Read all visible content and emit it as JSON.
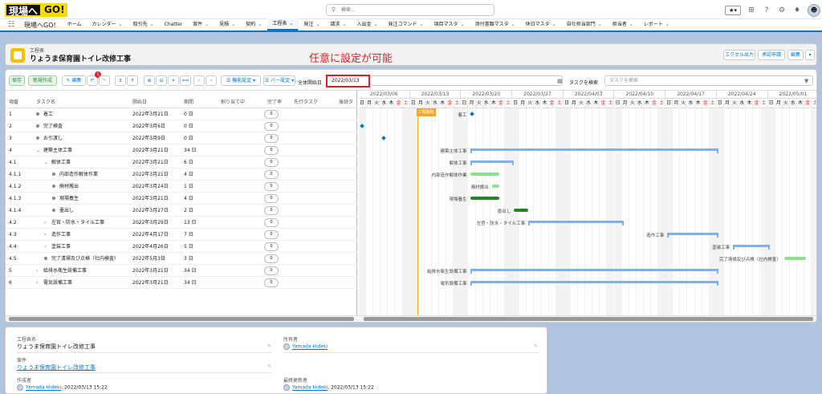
{
  "topbar": {
    "logo_text": "現場へ",
    "logo_text2": "GO!",
    "search_placeholder": "検索...",
    "fav_label": "★▾"
  },
  "nav": {
    "app_name": "現場へGO!",
    "tabs": [
      {
        "label": "ホーム",
        "dropdown": false
      },
      {
        "label": "カレンダー",
        "dropdown": true
      },
      {
        "label": "取引先",
        "dropdown": true
      },
      {
        "label": "Chatter",
        "dropdown": false
      },
      {
        "label": "案件",
        "dropdown": true
      },
      {
        "label": "見積",
        "dropdown": true
      },
      {
        "label": "契約",
        "dropdown": true
      },
      {
        "label": "工程表",
        "dropdown": true,
        "active": true
      },
      {
        "label": "発注",
        "dropdown": true
      },
      {
        "label": "請求",
        "dropdown": true
      },
      {
        "label": "入出金",
        "dropdown": true
      },
      {
        "label": "発注コマンド",
        "dropdown": true
      },
      {
        "label": "項目マスタ",
        "dropdown": true
      },
      {
        "label": "添付書類マスタ",
        "dropdown": true
      },
      {
        "label": "休日マスタ",
        "dropdown": true
      },
      {
        "label": "自社担当部門",
        "dropdown": true
      },
      {
        "label": "担当者",
        "dropdown": true
      },
      {
        "label": "レポート",
        "dropdown": true
      }
    ]
  },
  "header": {
    "object_type": "工程表",
    "record_name": "りょうま保育園トイレ改修工事",
    "buttons": [
      "エクセル出力",
      "承認申請",
      "編集"
    ],
    "more": "▾"
  },
  "annotation": "任意に設定が可能",
  "toolbar": {
    "save": "保存",
    "new": "新規作成",
    "edit": "編集",
    "undo_badge": "1",
    "function_settings": "機能設定",
    "bar_settings": "バー設定",
    "start_label": "全体開始日",
    "start_date": "2022/03/13",
    "task_search_label": "タスクを検索",
    "task_search_placeholder": "タスクを検索"
  },
  "grid": {
    "headers": [
      "項番",
      "タスク名",
      "開始日",
      "期間",
      "割り当て中",
      "完了率",
      "先行タスク",
      "後続タ"
    ],
    "rows": [
      {
        "no": "1",
        "name": "着工",
        "level": 1,
        "type": "task",
        "start": "2022年3月21日",
        "duration": "0 日",
        "pct": "0"
      },
      {
        "no": "2",
        "name": "完了検査",
        "level": 1,
        "type": "task",
        "start": "2022年3月6日",
        "duration": "0 日",
        "pct": "0"
      },
      {
        "no": "3",
        "name": "お引渡し",
        "level": 1,
        "type": "task",
        "start": "2022年3月9日",
        "duration": "0 日",
        "pct": "0"
      },
      {
        "no": "4",
        "name": "建築主体工事",
        "level": 1,
        "type": "open",
        "start": "2022年3月21日",
        "duration": "34 日",
        "pct": "0"
      },
      {
        "no": "4.1",
        "name": "解体工事",
        "level": 2,
        "type": "open",
        "start": "2022年3月21日",
        "duration": "6 日",
        "pct": "0"
      },
      {
        "no": "4.1.1",
        "name": "内部造作解体作業",
        "level": 3,
        "type": "task",
        "start": "2022年3月21日",
        "duration": "4 日",
        "pct": "0"
      },
      {
        "no": "4.1.2",
        "name": "廃材搬出",
        "level": 3,
        "type": "task",
        "start": "2022年3月24日",
        "duration": "1 日",
        "pct": "0"
      },
      {
        "no": "4.1.3",
        "name": "現場養生",
        "level": 3,
        "type": "task",
        "start": "2022年3月21日",
        "duration": "4 日",
        "pct": "0"
      },
      {
        "no": "4.1.4",
        "name": "墨出し",
        "level": 3,
        "type": "task",
        "start": "2022年3月27日",
        "duration": "2 日",
        "pct": "0"
      },
      {
        "no": "4.2",
        "name": "左官・防水・タイル工事",
        "level": 2,
        "type": "closed",
        "start": "2022年3月29日",
        "duration": "13 日",
        "pct": "0"
      },
      {
        "no": "4.3",
        "name": "造作工事",
        "level": 2,
        "type": "closed",
        "start": "2022年4月17日",
        "duration": "7 日",
        "pct": "0"
      },
      {
        "no": "4.4",
        "name": "塗装工事",
        "level": 2,
        "type": "closed",
        "start": "2022年4月26日",
        "duration": "5 日",
        "pct": "0"
      },
      {
        "no": "4.5",
        "name": "完了清掃及び点検（社内検査）",
        "level": 2,
        "type": "task",
        "start": "2022年5月3日",
        "duration": "3 日",
        "pct": "0"
      },
      {
        "no": "5",
        "name": "給排水衛生設備工事",
        "level": 1,
        "type": "closed",
        "start": "2022年3月21日",
        "duration": "34 日",
        "pct": "0"
      },
      {
        "no": "6",
        "name": "電気設備工事",
        "level": 1,
        "type": "closed",
        "start": "2022年3月21日",
        "duration": "34 日",
        "pct": "0"
      }
    ]
  },
  "gantt": {
    "weeks": [
      "2022/03/06",
      "2022/03/13",
      "2022/03/20",
      "2022/03/27",
      "2022/04/03",
      "2022/04/10",
      "2022/04/17",
      "2022/04/24",
      "2022/05/01"
    ],
    "day_labels": [
      "日",
      "月",
      "火",
      "水",
      "木",
      "金",
      "土"
    ],
    "today_label": "工程開始",
    "bar_labels": [
      "着工",
      "完了検査",
      "",
      "建築主体工事",
      "解体工事",
      "内部造作解体作業",
      "廃材搬出",
      "現場養生",
      "墨出し",
      "左官・防水・タイル工事",
      "造作工事",
      "塗装工事",
      "完了清掃及び点検（社内検査）",
      "給排水衛生設備工事",
      "電気設備工事"
    ],
    "summary_color": "#7eb0ec",
    "task_light_color": "#8ee08e",
    "task_dark_color": "#1e8a1e"
  },
  "details": {
    "f1_label": "工程表名",
    "f1_value": "りょうま保育園トイレ改修工事",
    "f2_label": "所有者",
    "f2_value": "Yamada Hideki",
    "f3_label": "案件",
    "f3_value": "りょうま保育園トイレ改修工事",
    "f4_label": "作成者",
    "f4_user": "Yamada Hideki",
    "f4_date": ", 2022/03/13 15:22",
    "f5_label": "最終更新者",
    "f5_user": "Yamada Hideki",
    "f5_date": ", 2022/03/13 15:22"
  }
}
